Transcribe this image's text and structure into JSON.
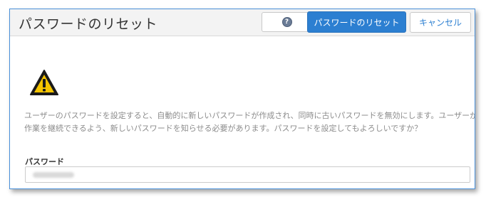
{
  "dialog": {
    "title": "パスワードのリセット",
    "help_icon": "question-circle-icon",
    "reset_button_label": "パスワードのリセット",
    "cancel_button_label": "キャンセル",
    "warning_icon": "warning-triangle-icon",
    "message_line_1": "ユーザーのパスワードを設定すると、自動的に新しいパスワードが作成され、同時に古いパスワードを無効にします。ユーザーが",
    "message_line_2": "作業を継続できるよう、新しいパスワードを知らせる必要があります。パスワードを設定してもよろしいですか？",
    "password_label": "パスワード",
    "password_value_obscured": true
  },
  "colors": {
    "accent": "#2c7fd1",
    "border": "#4a90d9",
    "header_bg": "#f3f3f3",
    "message_text": "#8c8c8c",
    "warning_yellow": "#f5c400"
  }
}
